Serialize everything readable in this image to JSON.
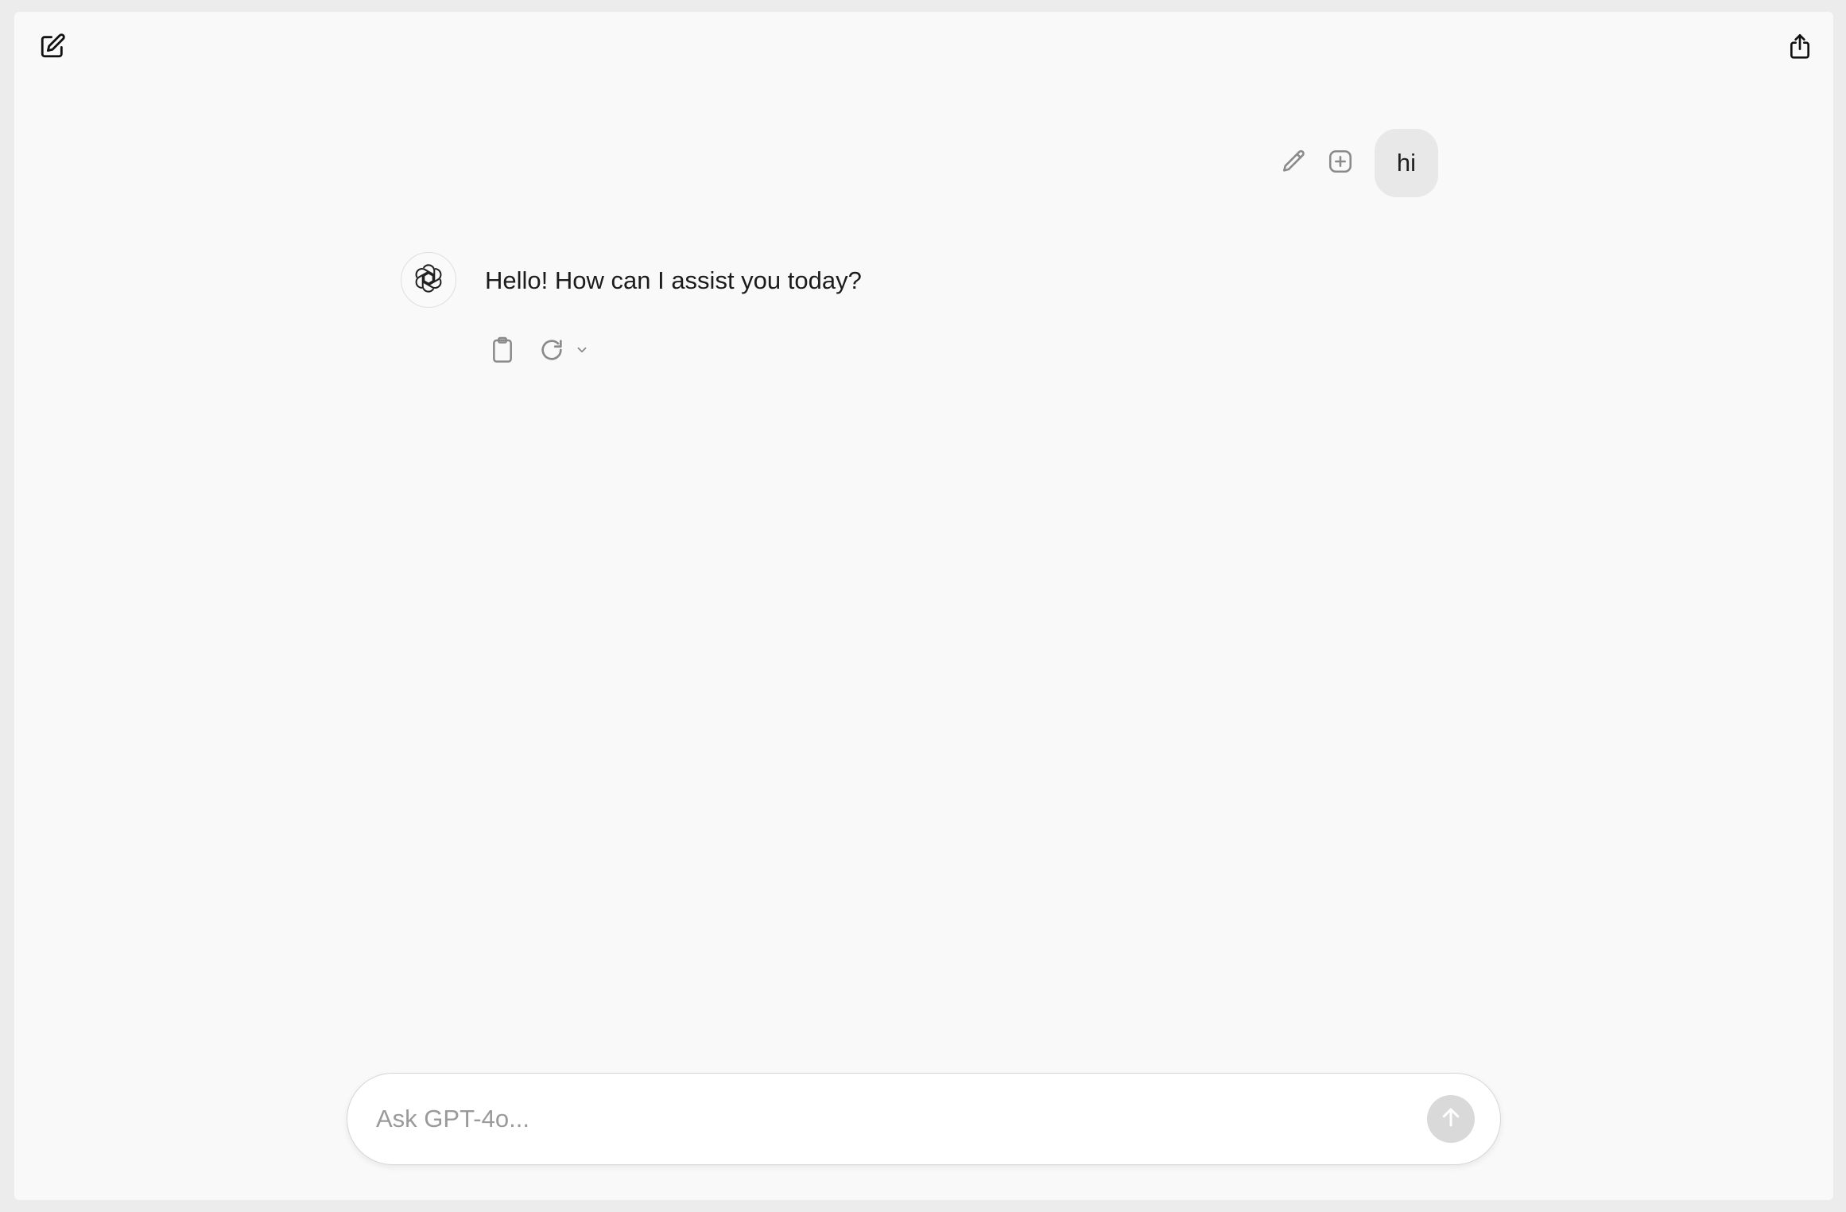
{
  "header": {
    "new_chat_icon": "compose-icon",
    "share_icon": "share-icon"
  },
  "conversation": {
    "user_message": {
      "text": "hi",
      "actions": [
        "edit-icon",
        "add-icon"
      ]
    },
    "assistant_message": {
      "avatar_icon": "openai-logo-icon",
      "text": "Hello! How can I assist you today?",
      "actions": [
        "clipboard-icon",
        "regenerate-icon",
        "chevron-down-icon"
      ]
    }
  },
  "composer": {
    "placeholder": "Ask GPT-4o...",
    "value": "",
    "send_icon": "arrow-up-icon"
  },
  "colors": {
    "background": "#f9f9f9",
    "outer": "#ececec",
    "user_bubble": "#e8e8e8",
    "send_button_disabled": "#d9d9d9",
    "text": "#1c1c1c",
    "icon_muted": "#8a8a8a"
  }
}
